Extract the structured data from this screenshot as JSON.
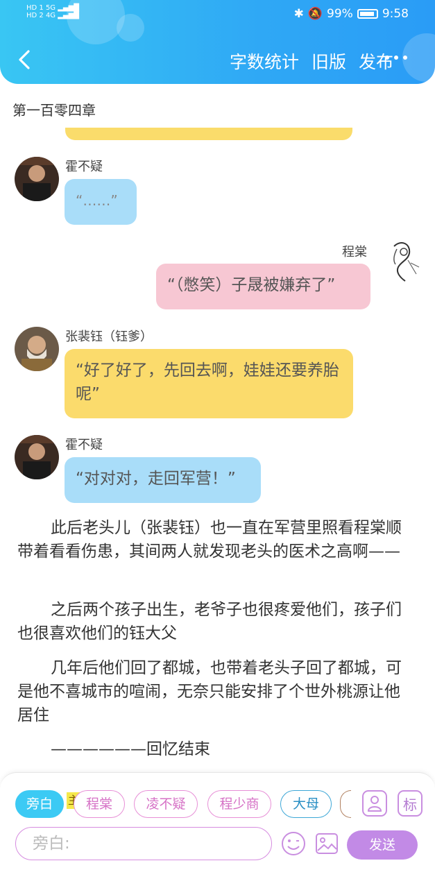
{
  "status": {
    "left_line1": "HD 1  5G ▂▄▆█",
    "left_line2": "HD 2  4G ▂▄▆█",
    "battery": "99%",
    "time": "9:58"
  },
  "header": {
    "nav": [
      "字数统计",
      "旧版",
      "发布"
    ]
  },
  "chapter_title": "第一百零四章",
  "messages": [
    {
      "speaker": "霍不疑",
      "text": "“……”"
    },
    {
      "speaker": "程棠",
      "text": "“（憋笑）子晟被嫌弃了”"
    },
    {
      "speaker": "张裴钰（钰爹）",
      "text": "“好了好了，先回去啊，娃娃还要养胎呢”"
    },
    {
      "speaker": "霍不疑",
      "text": "“对对对，走回军营！”"
    }
  ],
  "paragraphs": [
    "此后老头儿（张裴钰）也一直在军营里照看程棠顺带着看看伤患，其间两人就发现老头的医术之高啊——",
    "之后两个孩子出生，老爷子也很疼爱他们，孩子们也很喜欢他们的钰大父",
    "几年后他们回了都城，也带着老头子回了都城，可是他不喜城市的喧闹，无奈只能安排了个世外桃源让他居住",
    "——————回忆结束"
  ],
  "composer": {
    "chips": [
      "旁白",
      "程棠",
      "凌不疑",
      "程少商",
      "大母"
    ],
    "zhu_badge": "主",
    "biao_label": "标",
    "input_placeholder": "旁白:",
    "send_label": "发送"
  },
  "colors": {
    "header": "#2fa8f5",
    "bubble_blue": "#a9ddf9",
    "bubble_pink": "#f7c7d3",
    "bubble_yellow": "#fbdb6c",
    "send": "#c28ae6"
  }
}
